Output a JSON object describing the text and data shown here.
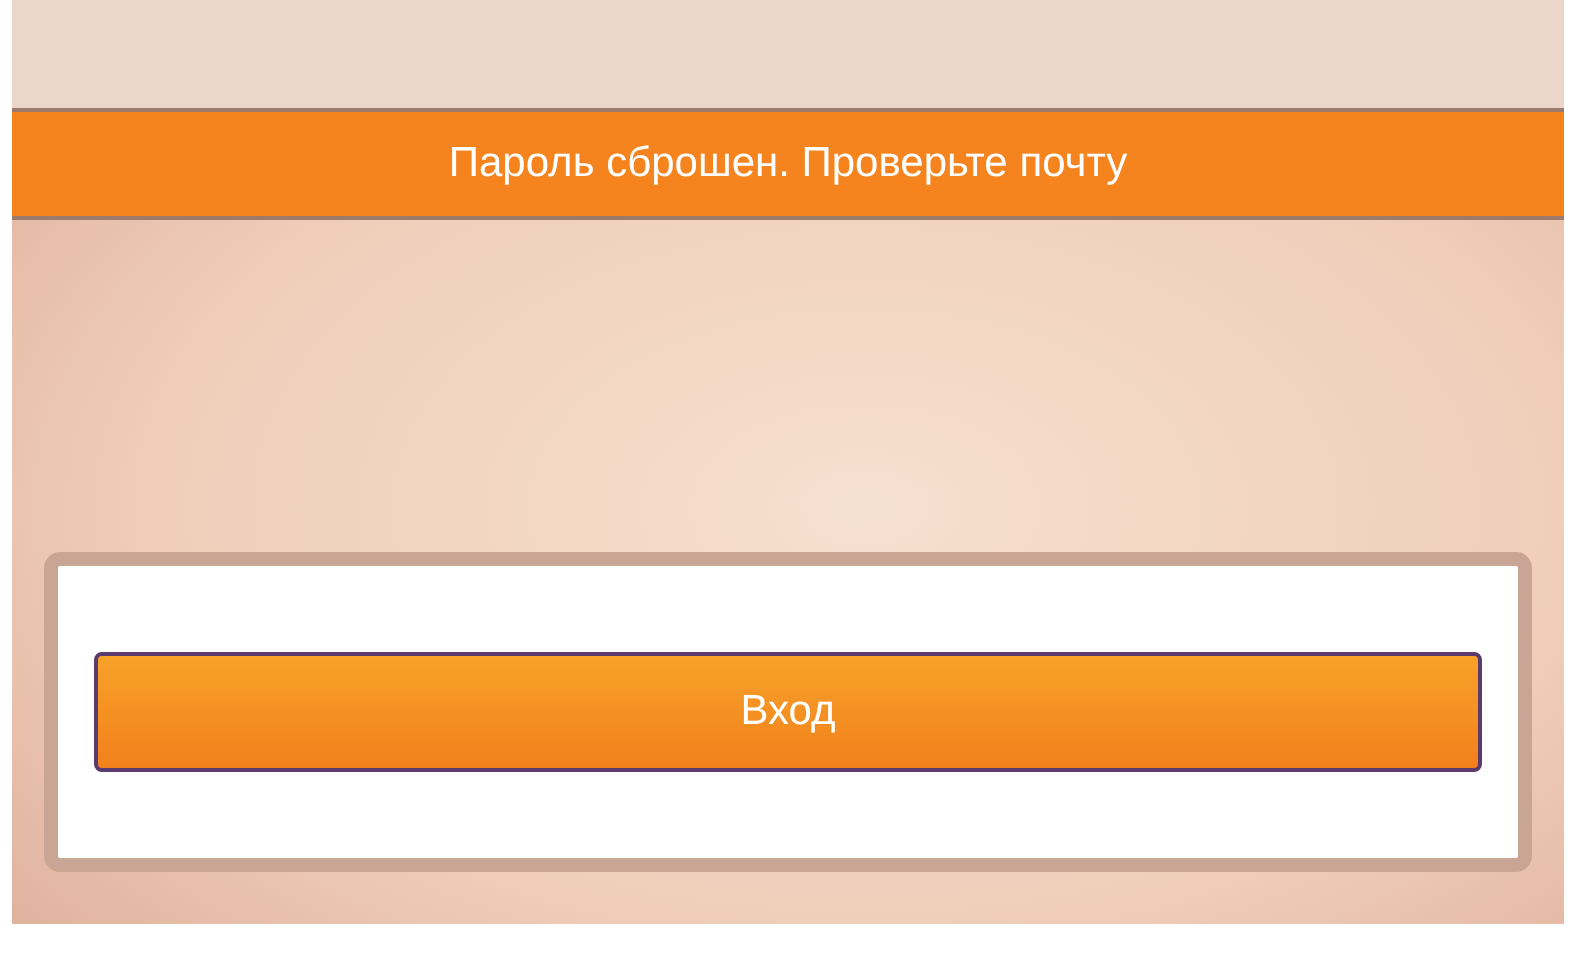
{
  "banner": {
    "message": "Пароль сброшен. Проверьте почту"
  },
  "login_button": {
    "label": "Вход"
  }
}
